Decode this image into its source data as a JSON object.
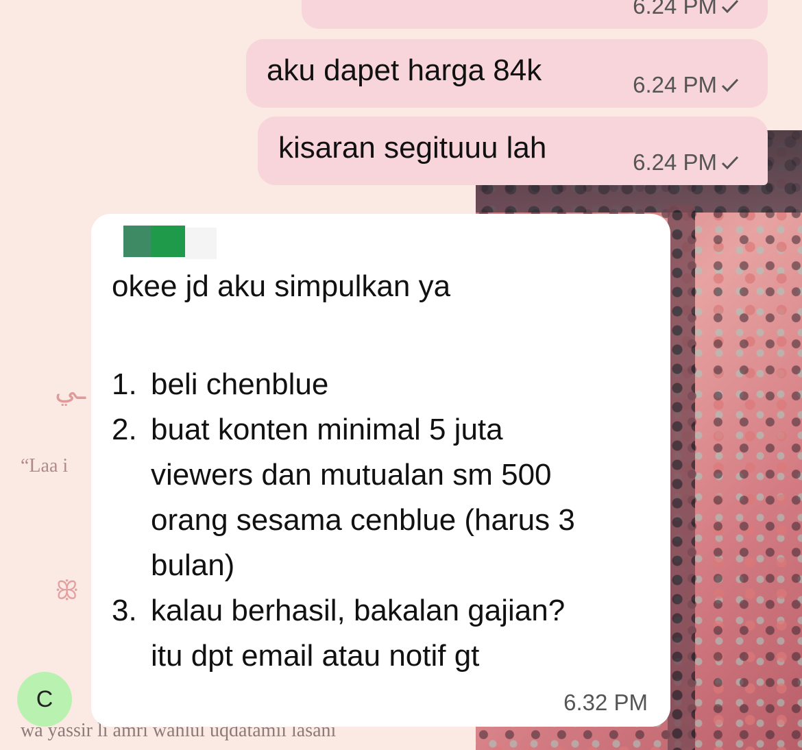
{
  "wallpaper": {
    "quote": "“Laa i",
    "bottom_text": "wa yassir li amri wahlul uqdatamii lasani",
    "arabic": "ـي",
    "ornament": "ꕥ"
  },
  "outgoing": [
    {
      "text": "",
      "time": "6.24 PM"
    },
    {
      "text": "aku dapet harga 84k",
      "time": "6.24 PM"
    },
    {
      "text": "kisaran segituuu lah",
      "time": "6.24 PM"
    }
  ],
  "incoming": {
    "first_line": "okee jd aku simpulkan ya",
    "items": [
      {
        "num": "1.",
        "lines": [
          "beli chenblue"
        ]
      },
      {
        "num": "2.",
        "lines": [
          "buat konten minimal 5 juta",
          "viewers dan mutualan sm 500",
          "orang sesama cenblue (harus 3",
          "bulan)"
        ]
      },
      {
        "num": "3.",
        "lines": [
          "kalau berhasil, bakalan gajian?",
          "itu dpt email atau notif gt"
        ]
      }
    ],
    "time": "6.32 PM"
  },
  "avatar": {
    "initial": "C",
    "color": "#b9f2b0"
  },
  "icons": {
    "tick": "check-icon"
  }
}
